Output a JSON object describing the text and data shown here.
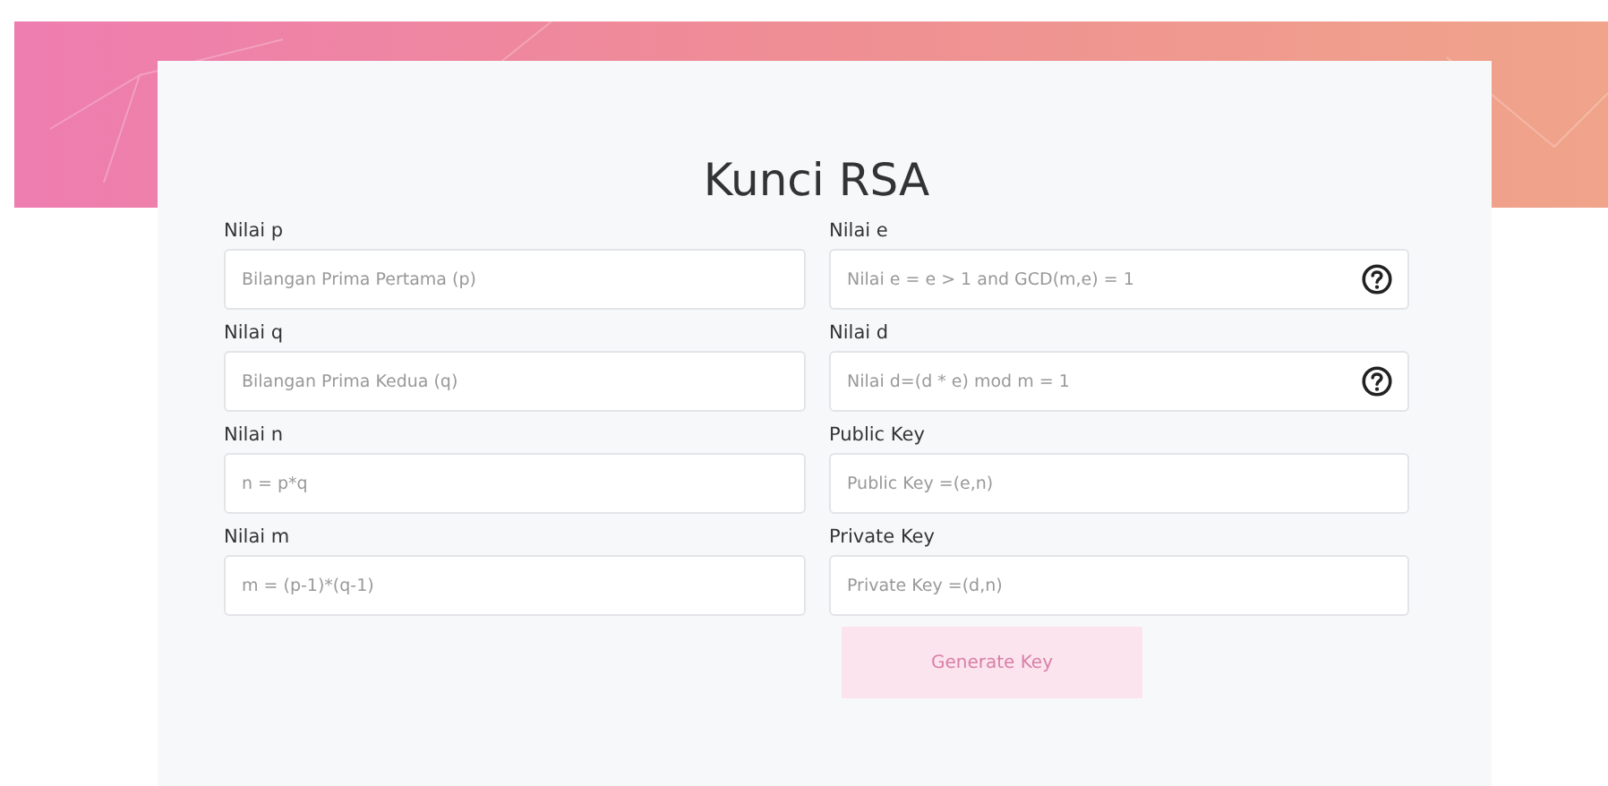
{
  "title": "Kunci RSA",
  "columns": [
    [
      {
        "label": "Nilai p",
        "placeholder": "Bilangan Prima Pertama (p)",
        "help": false
      },
      {
        "label": "Nilai q",
        "placeholder": "Bilangan Prima Kedua (q)",
        "help": false
      },
      {
        "label": "Nilai n",
        "placeholder": "n = p*q",
        "help": false
      },
      {
        "label": "Nilai m",
        "placeholder": "m = (p-1)*(q-1)",
        "help": false
      }
    ],
    [
      {
        "label": "Nilai e",
        "placeholder": "Nilai e = e > 1 and GCD(m,e) = 1",
        "help": true
      },
      {
        "label": "Nilai d",
        "placeholder": "Nilai d=(d * e) mod m = 1",
        "help": true
      },
      {
        "label": "Public Key",
        "placeholder": "Public Key =(e,n)",
        "help": false
      },
      {
        "label": "Private Key",
        "placeholder": "Private Key =(d,n)",
        "help": false
      }
    ]
  ],
  "button": {
    "label": "Generate Key",
    "disabled": true
  }
}
